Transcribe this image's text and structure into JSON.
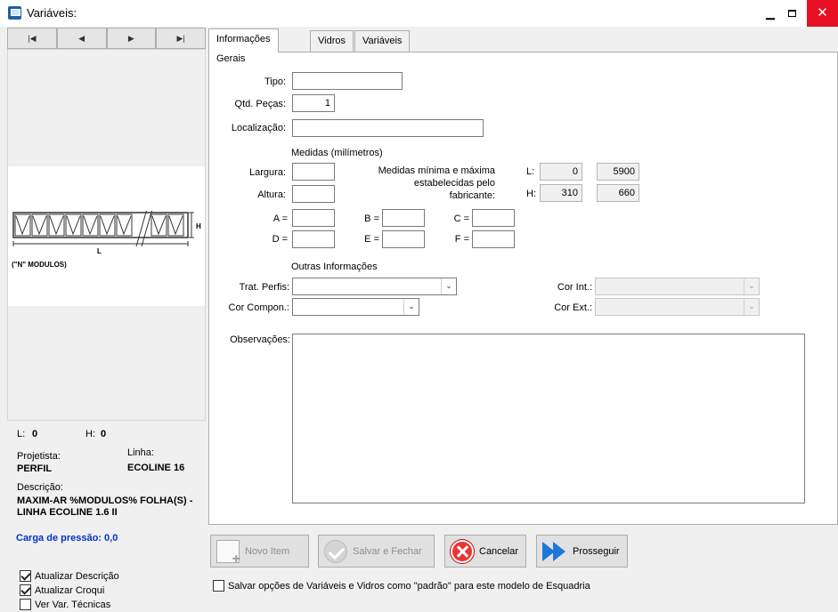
{
  "window": {
    "title": "Variáveis:",
    "minimize": "▁",
    "maximize": "",
    "close": "✕"
  },
  "nav": {
    "first": "|◀",
    "prev": "◀",
    "next": "▶",
    "last": "▶|"
  },
  "preview": {
    "h_mark": "H",
    "l_mark": "L",
    "modules_label": "(\"N\" MODULOS)"
  },
  "info": {
    "l_label": "L:",
    "l_value": "0",
    "h_label": "H:",
    "h_value": "0",
    "projetista_label": "Projetista:",
    "projetista_value": "PERFIL",
    "linha_label": "Linha:",
    "linha_value": "ECOLINE 16",
    "descricao_label": "Descrição:",
    "descricao_line1": "MAXIM-AR %MODULOS% FOLHA(S) -",
    "descricao_line2": "LINHA ECOLINE 1.6 II",
    "carga": "Carga de pressão: 0,0"
  },
  "options": [
    {
      "label": "Atualizar Descrição",
      "checked": true
    },
    {
      "label": "Atualizar Croqui",
      "checked": true
    },
    {
      "label": "Ver Var. Técnicas",
      "checked": false
    }
  ],
  "tabs": [
    "Informações Gerais",
    "Vidros",
    "Variáveis"
  ],
  "form": {
    "tipo_label": "Tipo:",
    "tipo_value": "",
    "qtd_label": "Qtd. Peças:",
    "qtd_value": "1",
    "local_label": "Localização:",
    "local_value": "",
    "medidas_title": "Medidas (milímetros)",
    "largura_label": "Largura:",
    "largura_value": "",
    "altura_label": "Altura:",
    "altura_value": "",
    "fab_line1": "Medidas mínima e máxima",
    "fab_line2": "estabelecidas pelo",
    "fab_line3": "fabricante:",
    "fab_l_label": "L:",
    "fab_l_min": "0",
    "fab_l_max": "5900",
    "fab_h_label": "H:",
    "fab_h_min": "310",
    "fab_h_max": "660",
    "a_label": "A =",
    "b_label": "B =",
    "c_label": "C =",
    "d_label": "D =",
    "e_label": "E =",
    "f_label": "F =",
    "outras_title": "Outras Informações",
    "trat_label": "Trat. Perfis:",
    "trat_value": "",
    "compon_label": "Cor Compon.:",
    "compon_value": "",
    "corint_label": "Cor Int.:",
    "corint_value": "",
    "corext_label": "Cor Ext.:",
    "corext_value": "",
    "obs_label": "Observações:",
    "obs_value": ""
  },
  "buttons": {
    "novo": "Novo Item",
    "salvar": "Salvar e Fechar",
    "cancelar": "Cancelar",
    "prosseguir": "Prosseguir"
  },
  "default_option": "Salvar opções de Variáveis e Vidros como \"padrão\" para este modelo de Esquadria",
  "icons": {
    "dropdown": "⌄"
  }
}
